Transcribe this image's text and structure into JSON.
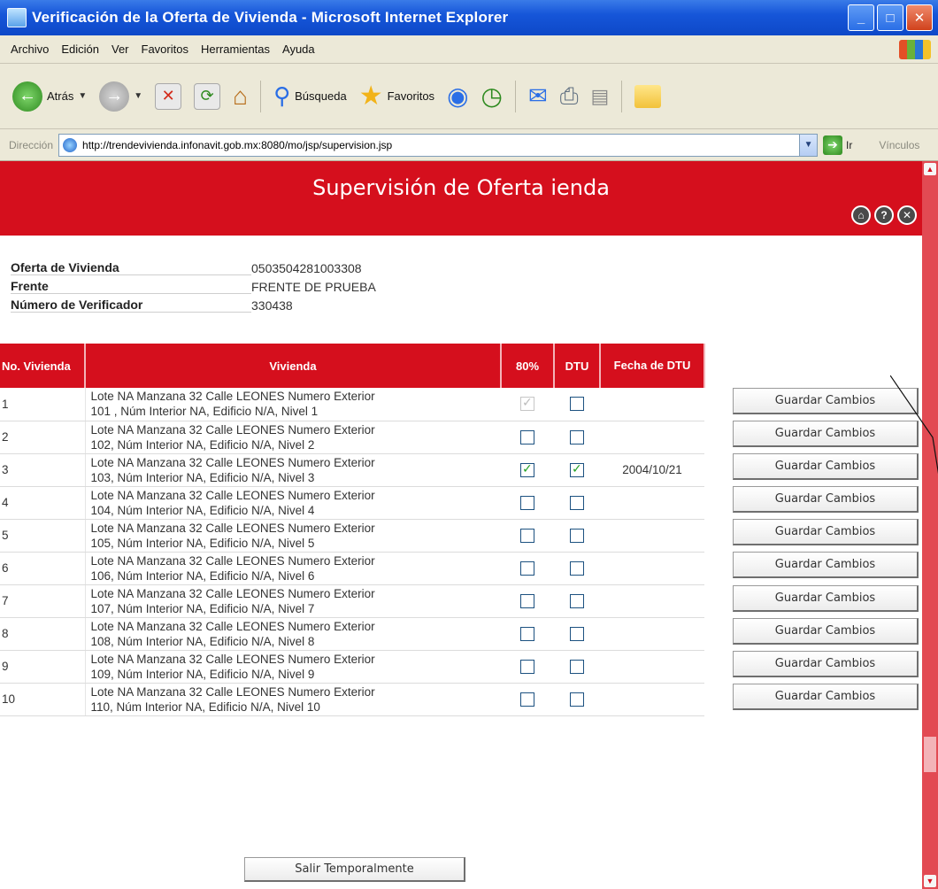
{
  "window": {
    "title": "Verificación de la Oferta de Vivienda - Microsoft Internet Explorer"
  },
  "menu": [
    "Archivo",
    "Edición",
    "Ver",
    "Favoritos",
    "Herramientas",
    "Ayuda"
  ],
  "toolbar": {
    "back_label": "Atrás",
    "search_label": "Búsqueda",
    "favorites_label": "Favoritos"
  },
  "address": {
    "label": "Dirección",
    "url": "http://trendevivienda.infonavit.gob.mx:8080/mo/jsp/supervision.jsp",
    "go_label": "Ir",
    "links_label": "Vínculos"
  },
  "page": {
    "title": "Supervisión de Oferta ienda",
    "info": [
      {
        "label": "Oferta de Vivienda",
        "value": "0503504281003308"
      },
      {
        "label": "Frente",
        "value": "FRENTE DE PRUEBA"
      },
      {
        "label": "Número de Verificador",
        "value": "330438"
      }
    ],
    "table": {
      "headers": {
        "no": "No. Vivienda",
        "vivienda": "Vivienda",
        "pct80": "80%",
        "dtu": "DTU",
        "fecha": "Fecha de DTU"
      },
      "rows": [
        {
          "no": "1",
          "line1": "Lote NA Manzana 32 Calle LEONES Numero Exterior",
          "line2": "101 , Núm Interior NA, Edificio N/A, Nivel 1",
          "pct80": true,
          "pct80_disabled": true,
          "dtu": false,
          "fecha": ""
        },
        {
          "no": "2",
          "line1": "Lote NA Manzana 32 Calle LEONES Numero Exterior",
          "line2": "102, Núm Interior NA, Edificio N/A, Nivel 2",
          "pct80": false,
          "pct80_disabled": false,
          "dtu": false,
          "fecha": ""
        },
        {
          "no": "3",
          "line1": "Lote NA Manzana 32 Calle LEONES Numero Exterior",
          "line2": "103, Núm Interior NA, Edificio N/A, Nivel 3",
          "pct80": true,
          "pct80_disabled": false,
          "dtu": true,
          "fecha": "2004/10/21"
        },
        {
          "no": "4",
          "line1": "Lote NA Manzana 32 Calle LEONES Numero Exterior",
          "line2": "104, Núm Interior NA, Edificio N/A, Nivel 4",
          "pct80": false,
          "pct80_disabled": false,
          "dtu": false,
          "fecha": ""
        },
        {
          "no": "5",
          "line1": "Lote NA Manzana 32 Calle LEONES Numero Exterior",
          "line2": "105, Núm Interior NA, Edificio N/A, Nivel 5",
          "pct80": false,
          "pct80_disabled": false,
          "dtu": false,
          "fecha": ""
        },
        {
          "no": "6",
          "line1": "Lote NA Manzana 32 Calle LEONES Numero Exterior",
          "line2": "106, Núm Interior NA, Edificio N/A, Nivel 6",
          "pct80": false,
          "pct80_disabled": false,
          "dtu": false,
          "fecha": ""
        },
        {
          "no": "7",
          "line1": "Lote NA Manzana 32 Calle LEONES Numero Exterior",
          "line2": "107, Núm Interior NA, Edificio N/A, Nivel 7",
          "pct80": false,
          "pct80_disabled": false,
          "dtu": false,
          "fecha": ""
        },
        {
          "no": "8",
          "line1": "Lote NA Manzana 32 Calle LEONES Numero Exterior",
          "line2": "108, Núm Interior NA, Edificio N/A, Nivel 8",
          "pct80": false,
          "pct80_disabled": false,
          "dtu": false,
          "fecha": ""
        },
        {
          "no": "9",
          "line1": "Lote NA Manzana 32 Calle LEONES Numero Exterior",
          "line2": "109, Núm Interior NA, Edificio N/A, Nivel 9",
          "pct80": false,
          "pct80_disabled": false,
          "dtu": false,
          "fecha": ""
        },
        {
          "no": "10",
          "line1": "Lote NA Manzana 32 Calle LEONES Numero Exterior",
          "line2": "110, Núm Interior NA, Edificio N/A, Nivel 10",
          "pct80": false,
          "pct80_disabled": false,
          "dtu": false,
          "fecha": ""
        }
      ]
    },
    "save_label": "Guardar Cambios",
    "exit_label": "Salir Temporalmente"
  },
  "colors": {
    "header_red": "#d50f1d",
    "titlebar_blue": "#1656d9"
  }
}
